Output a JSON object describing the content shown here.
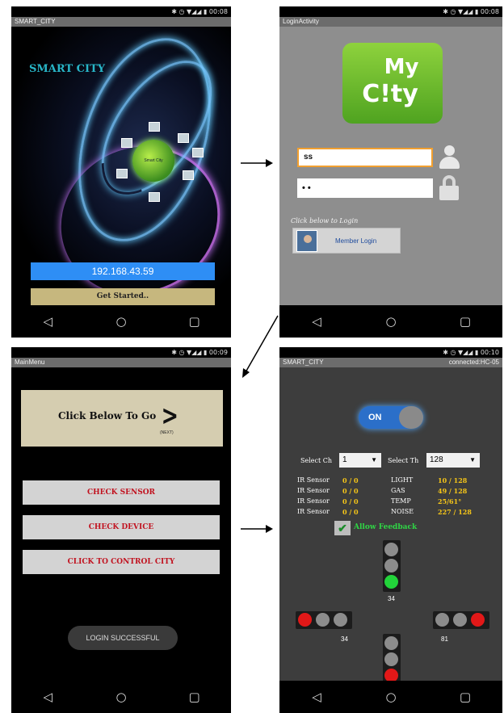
{
  "status_bar": {
    "time1": "✱ ◷ ▼◢◢ ▮ 00:08",
    "time2": "✱ ◷ ▼◢◢ ▮ 00:08",
    "time3": "✱ ◷ ▼◢◢ ▮ 00:09",
    "time4": "✱ ◷ ▼◢◢ ▮ 00:10"
  },
  "nav": {
    "back": "◁",
    "home": "○",
    "recent": "▢"
  },
  "splash": {
    "title_bar": "SMART_CITY",
    "app_title": "SMART CITY",
    "globe_text": "Smart City",
    "ip_address": "192.168.43.59",
    "get_started": "Get Started.."
  },
  "login": {
    "title_bar": "LoginActivity",
    "logo_line1": "My",
    "logo_line2": "C!ty",
    "username": "ss",
    "password": "• •",
    "click_below": "Click below to Login",
    "member_login": "Member Login"
  },
  "main_menu": {
    "title_bar": "MainMenu",
    "click_below": "Click Below To Go",
    "next_arrow": ">",
    "next_small": "(NEXT)",
    "buttons": [
      "CHECK SENSOR",
      "CHECK DEVICE",
      "CLICK TO CONTROL CITY"
    ],
    "toast": "LOGIN SUCCESSFUL"
  },
  "control": {
    "title_bar": "SMART_CITY",
    "connection": "connected:HC-05",
    "toggle": "ON",
    "select_ch_label": "Select Ch",
    "select_ch_value": "1",
    "select_th_label": "Select Th",
    "select_th_value": "128",
    "rows": [
      {
        "name": "IR Sensor",
        "value": "0 / 0",
        "metric": "LIGHT",
        "metric_value": "10 / 128"
      },
      {
        "name": "IR Sensor",
        "value": "0 / 0",
        "metric": "GAS",
        "metric_value": "49 / 128"
      },
      {
        "name": "IR Sensor",
        "value": "0 / 0",
        "metric": "TEMP",
        "metric_value": "25/61°"
      },
      {
        "name": "IR Sensor",
        "value": "0 / 0",
        "metric": "NOISE",
        "metric_value": "227 / 128"
      }
    ],
    "feedback_check": "✔",
    "allow_feedback": "Allow Feedback",
    "counts": {
      "north": "34",
      "west": "34",
      "east": "81"
    }
  },
  "colors": {
    "login_green": "#8ed23d",
    "ip_blue": "#2e8ef5",
    "menu_red": "#c1121f",
    "feedback_green": "#2fd545",
    "sensor_yellow": "#f5c518"
  }
}
